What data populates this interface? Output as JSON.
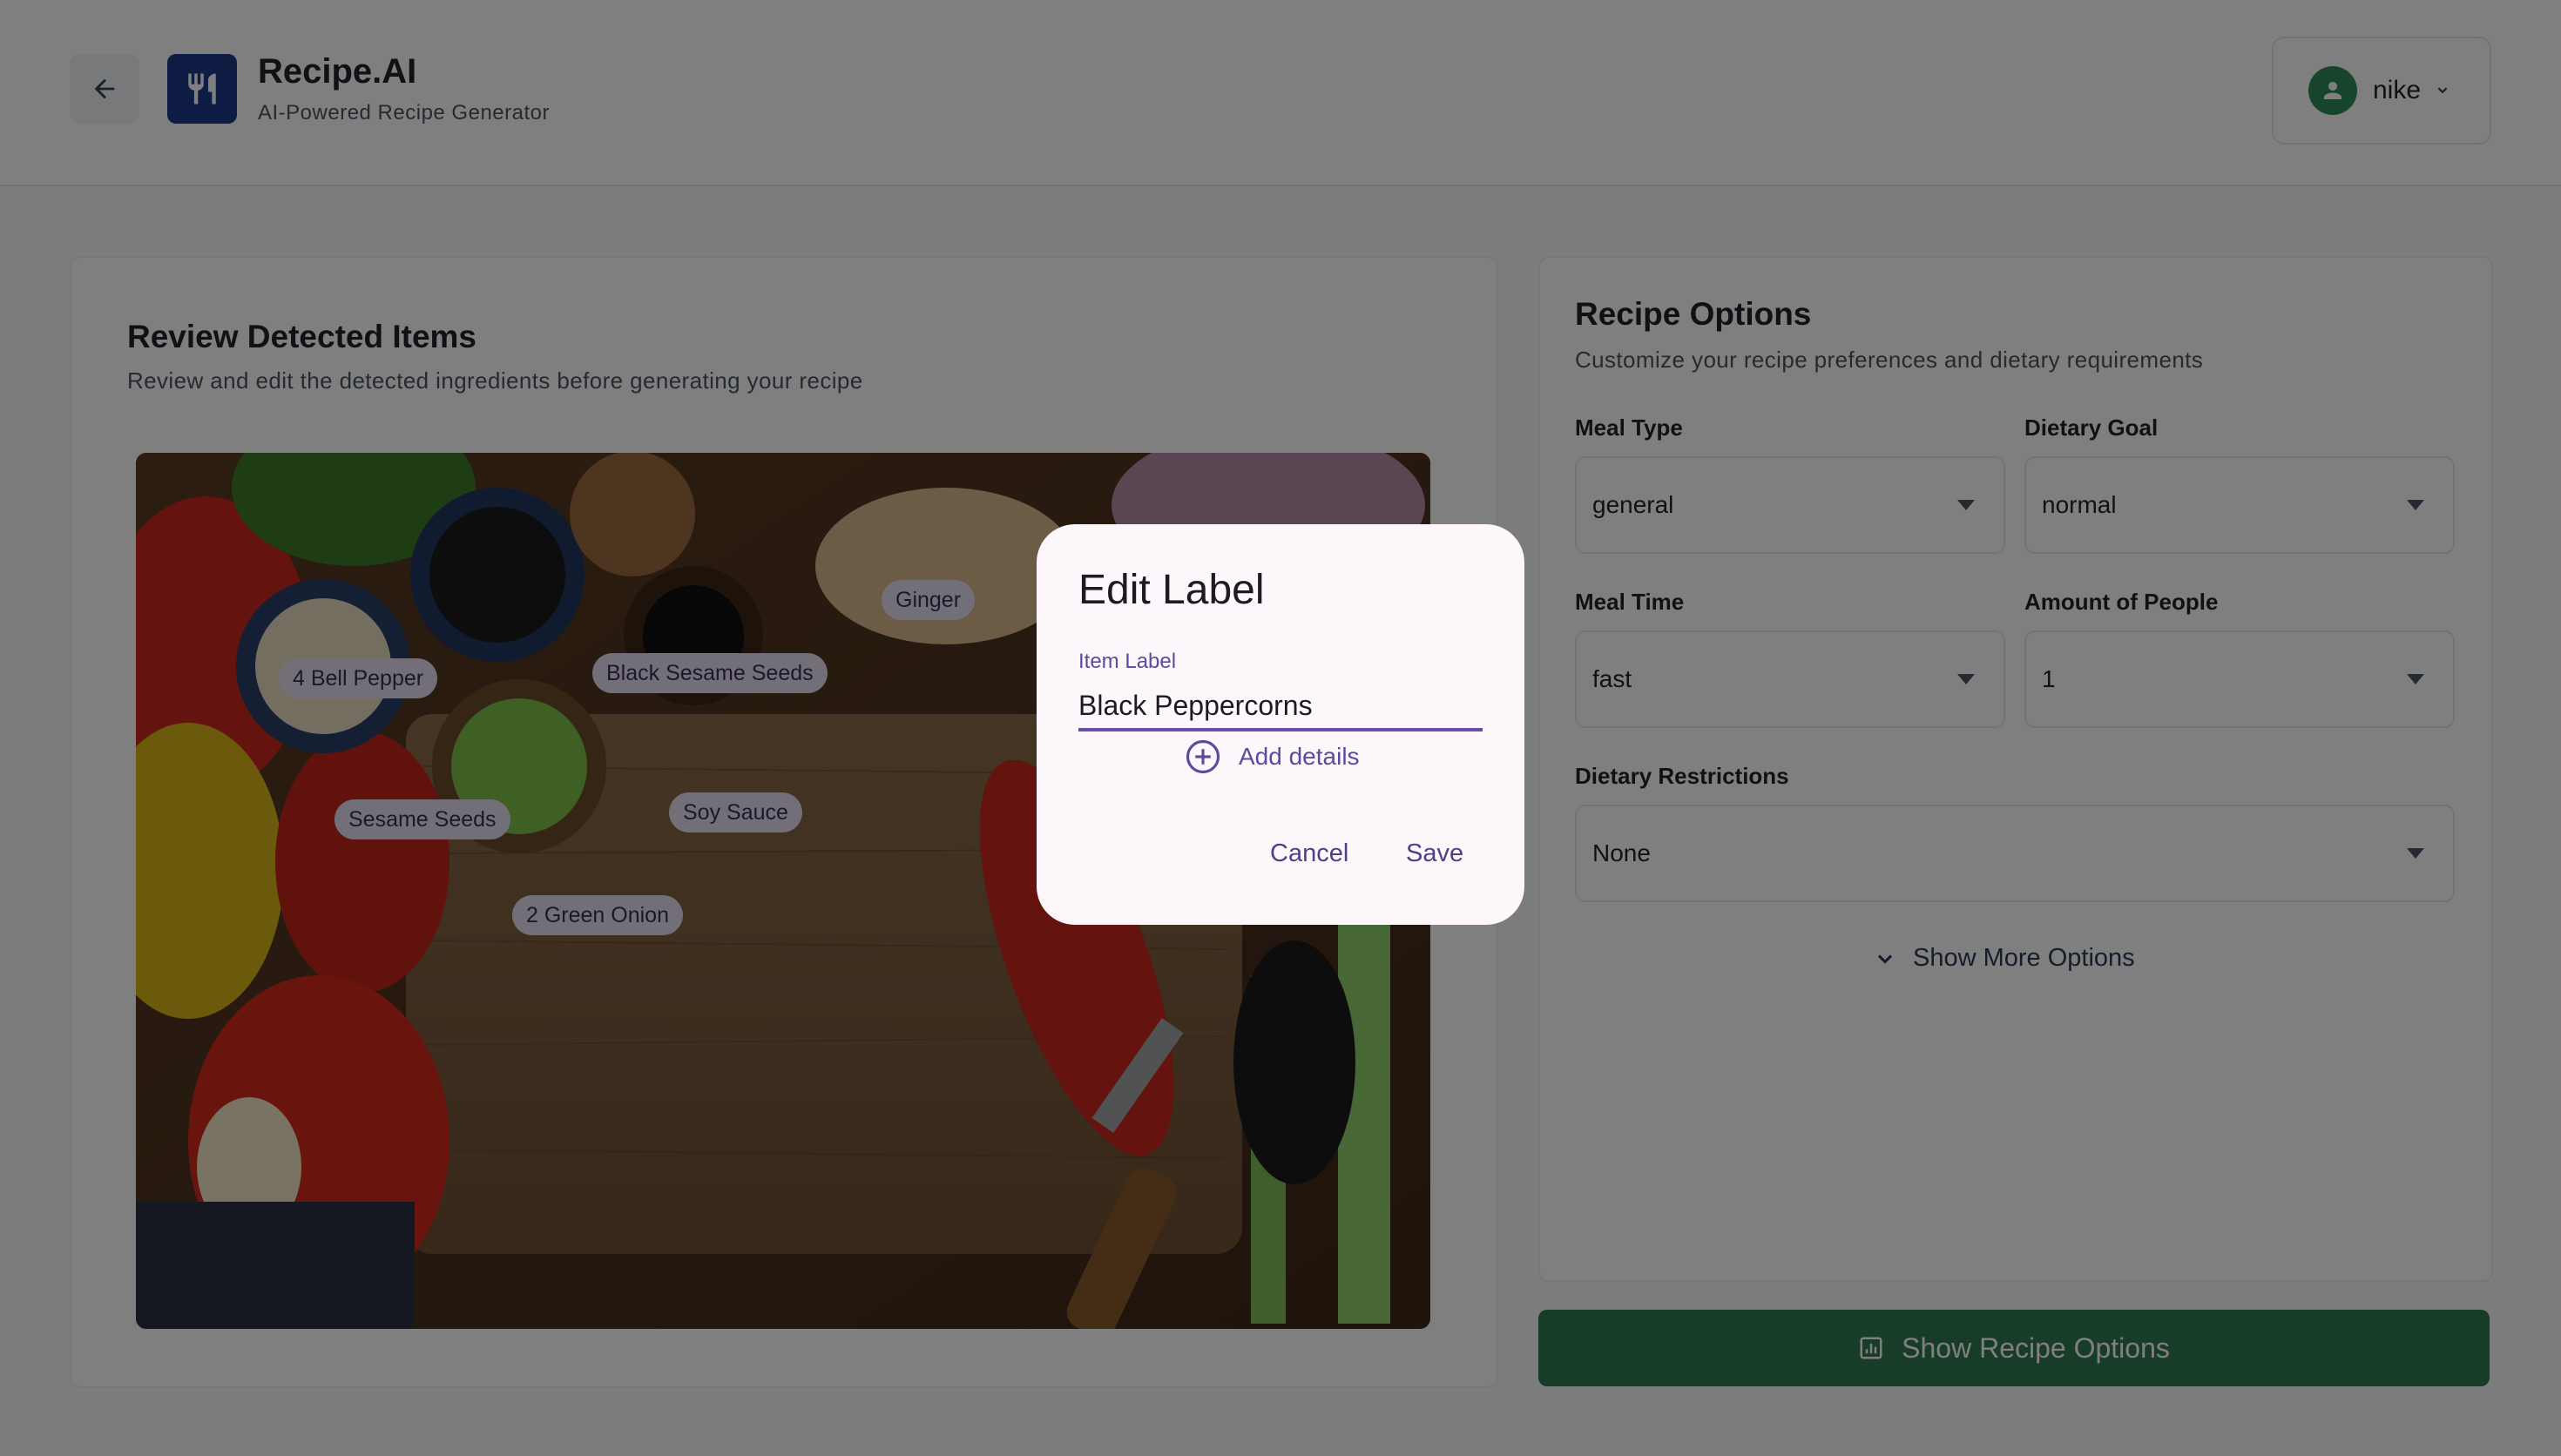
{
  "header": {
    "back_icon": "arrow-left-icon",
    "logo_icon": "fork-knife-icon",
    "title": "Recipe.AI",
    "subtitle": "AI-Powered Recipe Generator",
    "user": {
      "name": "nike",
      "avatar_icon": "user-icon",
      "dropdown_icon": "chevron-down-icon"
    }
  },
  "review": {
    "title": "Review Detected Items",
    "subtitle": "Review and edit the detected ingredients before generating your recipe",
    "tags": [
      "Ginger",
      "4 Bell Pepper",
      "Black Sesame Seeds",
      "Sesame Seeds",
      "Soy Sauce",
      "2 Green Onion"
    ]
  },
  "options": {
    "title": "Recipe Options",
    "subtitle": "Customize your recipe preferences and dietary requirements",
    "meal_type": {
      "label": "Meal Type",
      "value": "general"
    },
    "dietary_goal": {
      "label": "Dietary Goal",
      "value": "normal"
    },
    "meal_time": {
      "label": "Meal Time",
      "value": "fast"
    },
    "amount_of_people": {
      "label": "Amount of People",
      "value": "1"
    },
    "dietary_restrictions": {
      "label": "Dietary Restrictions",
      "value": "None"
    },
    "show_more": "Show More Options"
  },
  "primary_button": {
    "label": "Show Recipe Options",
    "icon": "chart-icon"
  },
  "dialog": {
    "title": "Edit Label",
    "field_label": "Item Label",
    "field_value": "Black Peppercorns",
    "add_details": "Add details",
    "cancel": "Cancel",
    "save": "Save"
  },
  "colors": {
    "brand": "#1e3a8a",
    "primary": "#2f7a52",
    "avatar": "#2f8a57",
    "tag_bg": "#e6def3",
    "dialog_bg": "#fdf7fc",
    "dialog_accent": "#6750a4"
  }
}
